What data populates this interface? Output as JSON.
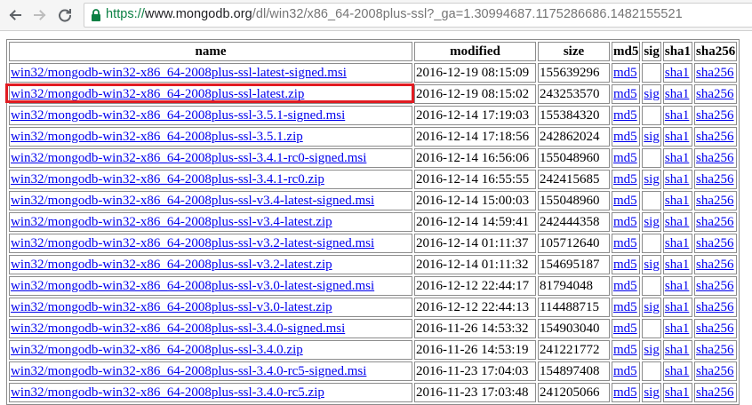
{
  "browser": {
    "url_scheme": "https://",
    "url_host": "www.mongodb.org",
    "url_path": "/dl/win32/x86_64-2008plus-ssl?_ga=1.30994687.1175286686.1482155521",
    "back_icon": "arrow-left-icon",
    "forward_icon": "arrow-right-icon",
    "reload_icon": "reload-icon",
    "lock_icon": "lock-icon",
    "secure_color": "#0b8043"
  },
  "table": {
    "headers": {
      "name": "name",
      "modified": "modified",
      "size": "size",
      "md5": "md5",
      "sig": "sig",
      "sha1": "sha1",
      "sha256": "sha256"
    },
    "link_color": "#0000ee",
    "highlight_color": "#e11b22",
    "highlighted_row": 1,
    "rows": [
      {
        "name": "win32/mongodb-win32-x86_64-2008plus-ssl-latest-signed.msi",
        "modified": "2016-12-19 08:15:09",
        "size": "155639296",
        "md5": "md5",
        "sig": "",
        "sha1": "sha1",
        "sha256": "sha256"
      },
      {
        "name": "win32/mongodb-win32-x86_64-2008plus-ssl-latest.zip",
        "modified": "2016-12-19 08:15:02",
        "size": "243253570",
        "md5": "md5",
        "sig": "sig",
        "sha1": "sha1",
        "sha256": "sha256"
      },
      {
        "name": "win32/mongodb-win32-x86_64-2008plus-ssl-3.5.1-signed.msi",
        "modified": "2016-12-14 17:19:03",
        "size": "155384320",
        "md5": "md5",
        "sig": "",
        "sha1": "sha1",
        "sha256": "sha256"
      },
      {
        "name": "win32/mongodb-win32-x86_64-2008plus-ssl-3.5.1.zip",
        "modified": "2016-12-14 17:18:56",
        "size": "242862024",
        "md5": "md5",
        "sig": "sig",
        "sha1": "sha1",
        "sha256": "sha256"
      },
      {
        "name": "win32/mongodb-win32-x86_64-2008plus-ssl-3.4.1-rc0-signed.msi",
        "modified": "2016-12-14 16:56:06",
        "size": "155048960",
        "md5": "md5",
        "sig": "",
        "sha1": "sha1",
        "sha256": "sha256"
      },
      {
        "name": "win32/mongodb-win32-x86_64-2008plus-ssl-3.4.1-rc0.zip",
        "modified": "2016-12-14 16:55:55",
        "size": "242415685",
        "md5": "md5",
        "sig": "sig",
        "sha1": "sha1",
        "sha256": "sha256"
      },
      {
        "name": "win32/mongodb-win32-x86_64-2008plus-ssl-v3.4-latest-signed.msi",
        "modified": "2016-12-14 15:00:03",
        "size": "155048960",
        "md5": "md5",
        "sig": "",
        "sha1": "sha1",
        "sha256": "sha256"
      },
      {
        "name": "win32/mongodb-win32-x86_64-2008plus-ssl-v3.4-latest.zip",
        "modified": "2016-12-14 14:59:41",
        "size": "242444358",
        "md5": "md5",
        "sig": "sig",
        "sha1": "sha1",
        "sha256": "sha256"
      },
      {
        "name": "win32/mongodb-win32-x86_64-2008plus-ssl-v3.2-latest-signed.msi",
        "modified": "2016-12-14 01:11:37",
        "size": "105712640",
        "md5": "md5",
        "sig": "",
        "sha1": "sha1",
        "sha256": "sha256"
      },
      {
        "name": "win32/mongodb-win32-x86_64-2008plus-ssl-v3.2-latest.zip",
        "modified": "2016-12-14 01:11:32",
        "size": "154695187",
        "md5": "md5",
        "sig": "sig",
        "sha1": "sha1",
        "sha256": "sha256"
      },
      {
        "name": "win32/mongodb-win32-x86_64-2008plus-ssl-v3.0-latest-signed.msi",
        "modified": "2016-12-12 22:44:17",
        "size": "81794048",
        "md5": "md5",
        "sig": "",
        "sha1": "sha1",
        "sha256": "sha256"
      },
      {
        "name": "win32/mongodb-win32-x86_64-2008plus-ssl-v3.0-latest.zip",
        "modified": "2016-12-12 22:44:13",
        "size": "114488715",
        "md5": "md5",
        "sig": "sig",
        "sha1": "sha1",
        "sha256": "sha256"
      },
      {
        "name": "win32/mongodb-win32-x86_64-2008plus-ssl-3.4.0-signed.msi",
        "modified": "2016-11-26 14:53:32",
        "size": "154903040",
        "md5": "md5",
        "sig": "",
        "sha1": "sha1",
        "sha256": "sha256"
      },
      {
        "name": "win32/mongodb-win32-x86_64-2008plus-ssl-3.4.0.zip",
        "modified": "2016-11-26 14:53:19",
        "size": "241221772",
        "md5": "md5",
        "sig": "sig",
        "sha1": "sha1",
        "sha256": "sha256"
      },
      {
        "name": "win32/mongodb-win32-x86_64-2008plus-ssl-3.4.0-rc5-signed.msi",
        "modified": "2016-11-23 17:04:03",
        "size": "154897408",
        "md5": "md5",
        "sig": "",
        "sha1": "sha1",
        "sha256": "sha256"
      },
      {
        "name": "win32/mongodb-win32-x86_64-2008plus-ssl-3.4.0-rc5.zip",
        "modified": "2016-11-23 17:03:48",
        "size": "241205066",
        "md5": "md5",
        "sig": "sig",
        "sha1": "sha1",
        "sha256": "sha256"
      }
    ]
  }
}
